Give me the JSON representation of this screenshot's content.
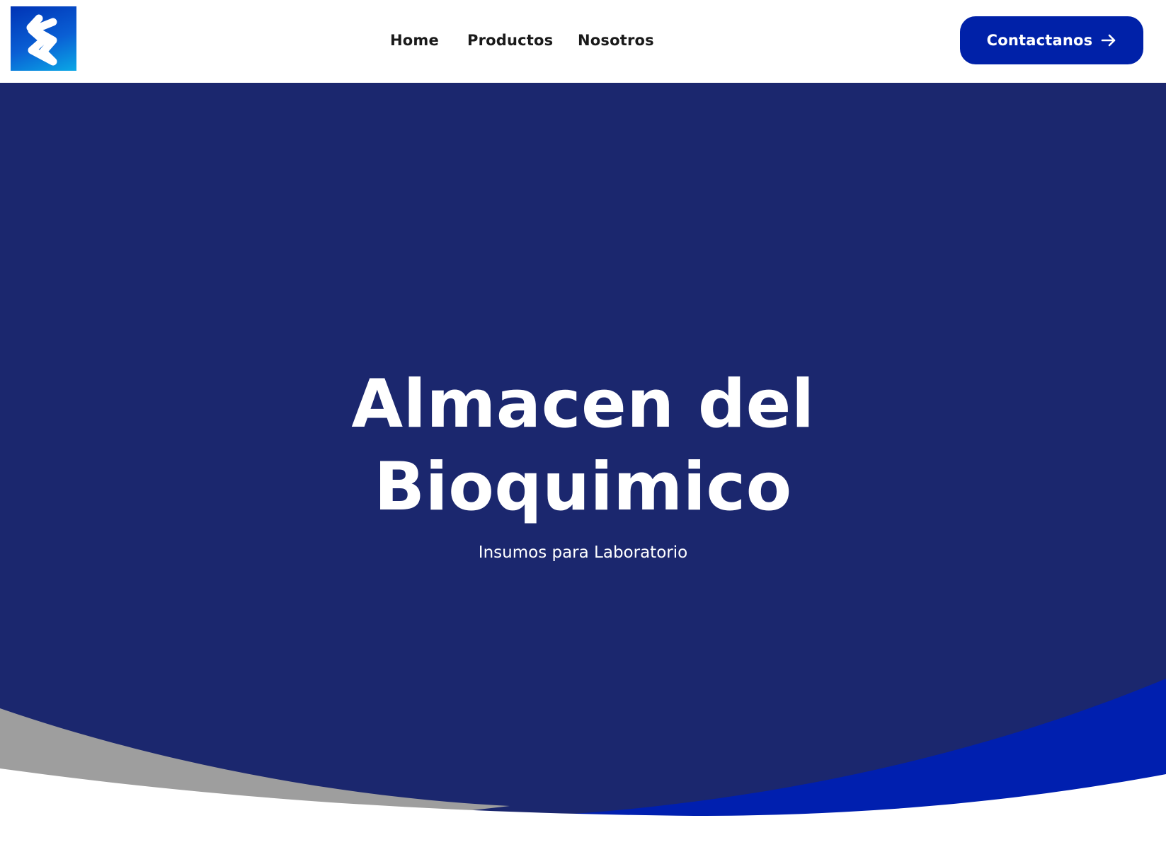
{
  "header": {
    "logo_icon": "brand-logo-icon",
    "nav": {
      "home": "Home",
      "productos": "Productos",
      "nosotros": "Nosotros"
    },
    "cta": {
      "label": "Contactanos",
      "icon": "arrow-right-icon"
    }
  },
  "hero": {
    "title_line1": "Almacen del",
    "title_line2": "Bioquimico",
    "subtitle": "Insumos para Laboratorio"
  },
  "colors": {
    "hero_background": "#1b276e",
    "cta_background": "#0021a8",
    "wave_blue": "#001faf",
    "wave_gray": "#9e9e9e",
    "logo_gradient_start": "#0033b5",
    "logo_gradient_end": "#0aa8e6"
  }
}
